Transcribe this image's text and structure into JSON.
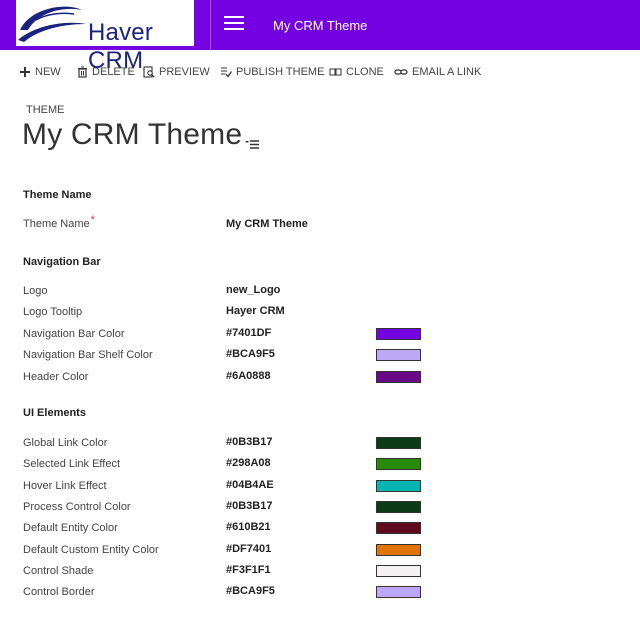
{
  "app": {
    "logo_text": "Haver CRM",
    "nav_title": "My CRM Theme",
    "nav_color": "#7401DF"
  },
  "toolbar": {
    "new": "NEW",
    "delete": "DELETE",
    "preview": "PREVIEW",
    "publish": "PUBLISH THEME",
    "clone": "CLONE",
    "email": "EMAIL A LINK",
    "icons": [
      "plus-icon",
      "trash-icon",
      "preview-icon",
      "publish-icon",
      "clone-icon",
      "link-icon"
    ]
  },
  "header": {
    "entity": "THEME",
    "title": "My CRM Theme"
  },
  "sections": {
    "theme_name": {
      "heading": "Theme Name",
      "label": "Theme Name",
      "required_mark": "*",
      "value": "My CRM Theme"
    },
    "navigation_bar": {
      "heading": "Navigation Bar",
      "logo_label": "Logo",
      "logo_value": "new_Logo",
      "tooltip_label": "Logo Tooltip",
      "tooltip_value": "Hayer CRM",
      "rows": [
        {
          "label": "Navigation Bar Color",
          "value": "#7401DF"
        },
        {
          "label": "Navigation Bar Shelf Color",
          "value": "#BCA9F5"
        },
        {
          "label": "Header Color",
          "value": "#6A0888"
        }
      ]
    },
    "ui_elements": {
      "heading": "UI Elements",
      "rows": [
        {
          "label": "Global Link Color",
          "value": "#0B3B17"
        },
        {
          "label": "Selected Link Effect",
          "value": "#298A08"
        },
        {
          "label": "Hover Link Effect",
          "value": "#04B4AE"
        },
        {
          "label": "Process Control Color",
          "value": "#0B3B17"
        },
        {
          "label": "Default Entity Color",
          "value": "#610B21"
        },
        {
          "label": "Default Custom Entity Color",
          "value": "#DF7401"
        },
        {
          "label": "Control Shade",
          "value": "#F3F1F1"
        },
        {
          "label": "Control Border",
          "value": "#BCA9F5"
        }
      ]
    }
  }
}
